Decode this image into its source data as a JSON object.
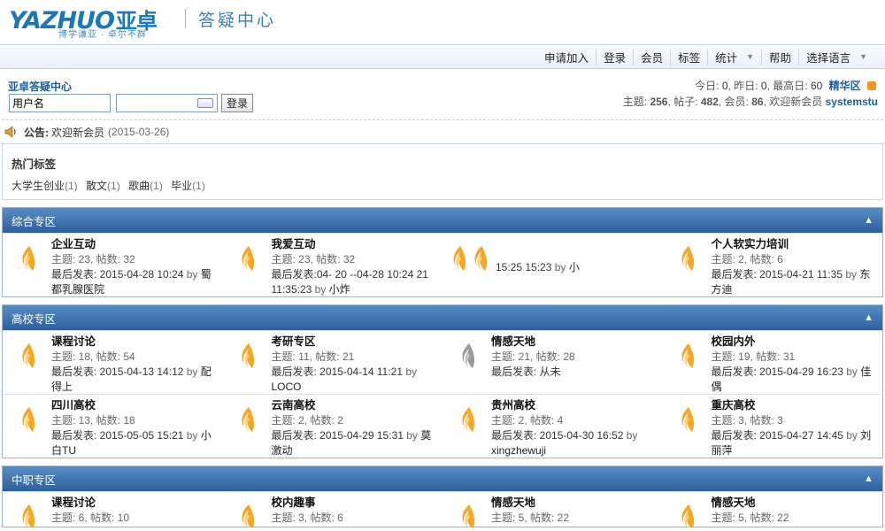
{
  "brand": {
    "logo_text": "YAZHUO",
    "logo_cn": "亚卓",
    "slogan": "博学谦亚 · 卓尔不群",
    "site_title": "答疑中心"
  },
  "nav": [
    "申请加入",
    "登录",
    "会员",
    "标签",
    "统计",
    "帮助",
    "选择语言"
  ],
  "userbar": {
    "forum_link": "亚卓答疑中心",
    "username_placeholder": "用户名",
    "login_button": "登录",
    "today_label": "今日:",
    "today": "0",
    "yesterday_label": "昨日:",
    "yesterday": "0",
    "max_label": "最高日:",
    "max": "60",
    "elite": "精华区",
    "topics_label": "主题:",
    "topics": "256",
    "posts_label": "帖子:",
    "posts": "482",
    "members_label": "会员:",
    "members": "86",
    "welcome": "欢迎新会员",
    "newest_member": "systemstu"
  },
  "announcement": {
    "label": "公告:",
    "text": "欢迎新会员",
    "date": "(2015-03-26)"
  },
  "hottags": {
    "title": "热门标签",
    "tags": [
      {
        "name": "大学生创业",
        "count": "(1)"
      },
      {
        "name": "散文",
        "count": "(1)"
      },
      {
        "name": "歌曲",
        "count": "(1)"
      },
      {
        "name": "毕业",
        "count": "(1)"
      }
    ]
  },
  "sections": [
    {
      "title": "综合专区",
      "rows": [
        [
          {
            "name": "企业互动",
            "meta": "主题: 23, 帖数: 32",
            "last": "最后发表: 2015-04-28 10:24",
            "by": "by",
            "who": "蜀都乳腺医院"
          },
          {
            "name": "我爱互动",
            "meta": "主题: 23, 帖数: 32",
            "last": "最后发表:04- 20 --04-28 10:24 21 11:35:23",
            "by": "by",
            "who": "小炸"
          },
          {
            "name": "",
            "meta": "",
            "last": "15:25 15:23",
            "by": "by",
            "who": "小"
          },
          {
            "name": "个人软实力培训",
            "meta": "主题: 2, 帖数: 6",
            "last": "最后发表: 2015-04-21 11:35",
            "by": "by",
            "who": "东方迪"
          }
        ]
      ]
    },
    {
      "title": "高校专区",
      "rows": [
        [
          {
            "name": "课程讨论",
            "meta": "主题: 18, 帖数: 54",
            "last": "最后发表: 2015-04-13 14:12",
            "by": "by",
            "who": "配得上"
          },
          {
            "name": "考研专区",
            "meta": "主题: 11, 帖数: 21",
            "last": "最后发表: 2015-04-14 11:21",
            "by": "by",
            "who": "LOCO"
          },
          {
            "name": "情感天地",
            "meta": "主题: 21, 帖数: 28",
            "last": "最后发表: 从未",
            "by": "",
            "who": ""
          },
          {
            "name": "校园内外",
            "meta": "主题: 19, 帖数: 31",
            "last": "最后发表: 2015-04-29 16:23",
            "by": "by",
            "who": "佳偶"
          }
        ],
        [
          {
            "name": "四川高校",
            "meta": "主题: 13, 帖数: 18",
            "last": "最后发表: 2015-05-05 15:21",
            "by": "by",
            "who": "小白TU"
          },
          {
            "name": "云南高校",
            "meta": "主题: 2, 帖数: 2",
            "last": "最后发表: 2015-04-29 15:31",
            "by": "by",
            "who": "莫激动"
          },
          {
            "name": "贵州高校",
            "meta": "主题: 2, 帖数: 4",
            "last": "最后发表: 2015-04-30 16:52",
            "by": "by",
            "who": "xingzhewuji"
          },
          {
            "name": "重庆高校",
            "meta": "主题: 3, 帖数: 3",
            "last": "最后发表: 2015-04-27 14:45",
            "by": "by",
            "who": "刘丽萍"
          }
        ]
      ]
    },
    {
      "title": "中职专区",
      "rows": [
        [
          {
            "name": "课程讨论",
            "meta": "主题: 6, 帖数: 10",
            "last": "",
            "by": "",
            "who": ""
          },
          {
            "name": "校内趣事",
            "meta": "主题: 3, 帖数: 6",
            "last": "",
            "by": "",
            "who": ""
          },
          {
            "name": "情感天地",
            "meta": "主题: 5, 帖数: 22",
            "last": "",
            "by": "",
            "who": ""
          },
          {
            "name": "情感天地",
            "meta": "主题: 5, 帖数: 22",
            "last": "",
            "by": "",
            "who": ""
          }
        ]
      ]
    }
  ],
  "colors": {
    "brand_blue": "#1b78b8",
    "link_blue": "#1b5d9c",
    "section_head_top": "#5a8cc4",
    "section_head_bottom": "#2e5f9c",
    "flame_active": "#f5a623",
    "flame_inactive": "#9a9a9a"
  },
  "icons": {
    "forum": "flame-icon",
    "forum_inactive": "flame-gray-icon",
    "announce": "speaker-icon",
    "collapse": "collapse-up-icon",
    "dropdown": "chevron-down-icon",
    "rss": "rss-icon",
    "keyboard": "keyboard-icon"
  }
}
